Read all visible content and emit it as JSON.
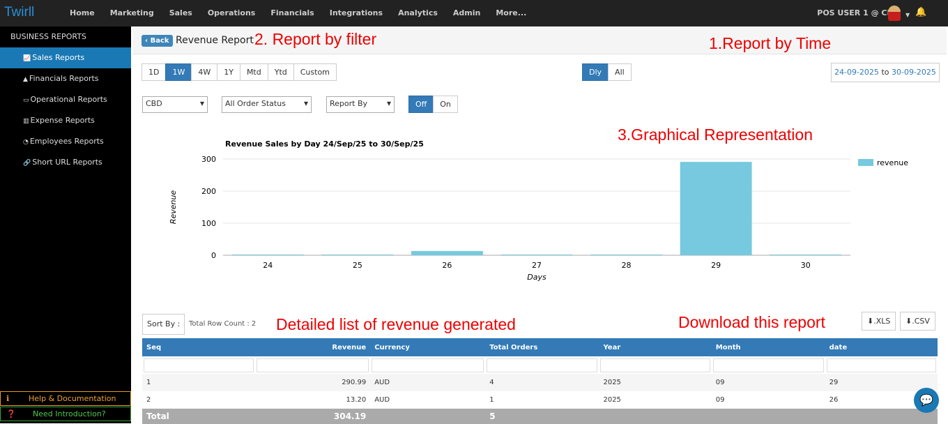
{
  "topbar": {
    "logo": "Twirll",
    "nav": [
      "Home",
      "Marketing",
      "Sales",
      "Operations",
      "Financials",
      "Integrations",
      "Analytics",
      "Admin",
      "More..."
    ],
    "user": "POS USER 1 @ CBD"
  },
  "sidebar": {
    "heading": "BUSINESS REPORTS",
    "items": [
      {
        "label": "Sales Reports",
        "icon": "chart-line-icon",
        "active": true
      },
      {
        "label": "Financials Reports",
        "icon": "chart-area-icon"
      },
      {
        "label": "Operational Reports",
        "icon": "credit-card-icon"
      },
      {
        "label": "Expense Reports",
        "icon": "bar-chart-icon"
      },
      {
        "label": "Employees Reports",
        "icon": "pie-chart-icon"
      },
      {
        "label": "Short URL Reports",
        "icon": "link-icon"
      }
    ],
    "help": "Help & Documentation",
    "intro": "Need Introduction?"
  },
  "header": {
    "back": "Back",
    "title": "Revenue Report"
  },
  "annotations": {
    "filter": "2. Report by filter",
    "time": "1.Report by Time",
    "graph": "3.Graphical Representation",
    "list": "Detailed list of revenue generated",
    "download": "Download this report"
  },
  "periods": {
    "items": [
      "1D",
      "1W",
      "4W",
      "1Y",
      "Mtd",
      "Ytd",
      "Custom"
    ],
    "selected": "1W"
  },
  "granularity": {
    "items": [
      "Dly",
      "All"
    ],
    "selected": "Dly"
  },
  "date_range": {
    "from": "24-09-2025",
    "sep": "to",
    "to": "30-09-2025"
  },
  "filters": {
    "location": "CBD",
    "order_status": "All Order Status",
    "report_by": "Report By",
    "toggle": [
      "Off",
      "On"
    ],
    "toggle_selected": "Off"
  },
  "colors": {
    "bar": "#76c9de",
    "accent": "#337ab7"
  },
  "chart_data": {
    "type": "bar",
    "title": "Revenue Sales by Day 24/Sep/25 to 30/Sep/25",
    "xlabel": "Days",
    "ylabel": "Revenue",
    "categories": [
      "24",
      "25",
      "26",
      "27",
      "28",
      "29",
      "30"
    ],
    "series": [
      {
        "name": "revenue",
        "values": [
          0,
          0,
          13.2,
          0,
          0,
          290.99,
          0
        ]
      }
    ],
    "ylim": [
      0,
      300
    ],
    "yticks": [
      0,
      100,
      200,
      300
    ],
    "grid": true,
    "legend": "right"
  },
  "table": {
    "sort_label": "Sort By :",
    "row_count": "Total Row Count : 2",
    "xls": ".XLS",
    "csv": ".CSV",
    "columns": [
      "Seq",
      "Revenue",
      "Currency",
      "Total Orders",
      "Year",
      "Month",
      "date"
    ],
    "rows": [
      [
        "1",
        "290.99",
        "AUD",
        "4",
        "2025",
        "09",
        "29"
      ],
      [
        "2",
        "13.20",
        "AUD",
        "1",
        "2025",
        "09",
        "26"
      ]
    ],
    "total": {
      "label": "Total",
      "revenue": "304.19",
      "orders": "5"
    }
  }
}
